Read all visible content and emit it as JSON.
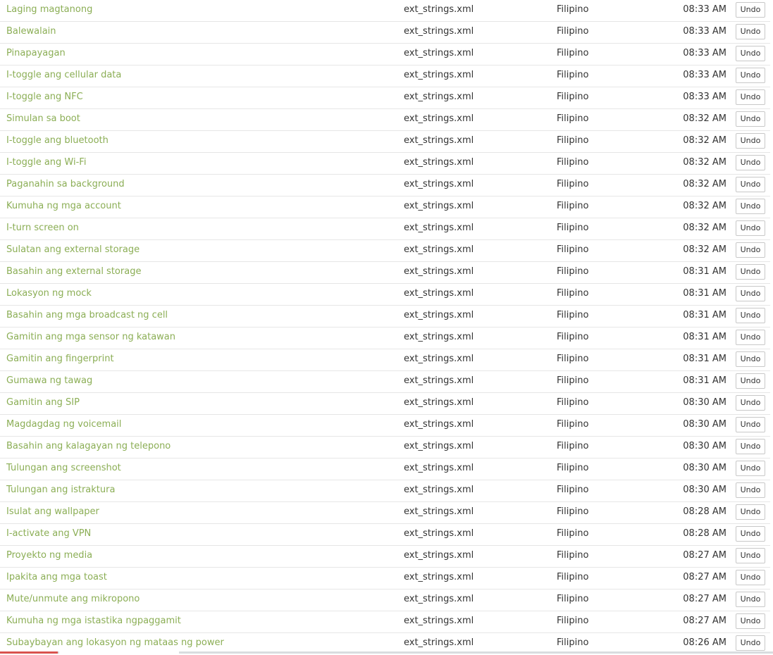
{
  "activity": {
    "undo_label": "Undo",
    "rows": [
      {
        "string": "Laging magtanong",
        "file": "ext_strings.xml",
        "language": "Filipino",
        "time": "08:33 AM"
      },
      {
        "string": "Balewalain",
        "file": "ext_strings.xml",
        "language": "Filipino",
        "time": "08:33 AM"
      },
      {
        "string": "Pinapayagan",
        "file": "ext_strings.xml",
        "language": "Filipino",
        "time": "08:33 AM"
      },
      {
        "string": "I-toggle ang cellular data",
        "file": "ext_strings.xml",
        "language": "Filipino",
        "time": "08:33 AM"
      },
      {
        "string": "I-toggle ang NFC",
        "file": "ext_strings.xml",
        "language": "Filipino",
        "time": "08:33 AM"
      },
      {
        "string": "Simulan sa boot",
        "file": "ext_strings.xml",
        "language": "Filipino",
        "time": "08:32 AM"
      },
      {
        "string": "I-toggle ang bluetooth",
        "file": "ext_strings.xml",
        "language": "Filipino",
        "time": "08:32 AM"
      },
      {
        "string": "I-toggle ang Wi-Fi",
        "file": "ext_strings.xml",
        "language": "Filipino",
        "time": "08:32 AM"
      },
      {
        "string": "Paganahin sa background",
        "file": "ext_strings.xml",
        "language": "Filipino",
        "time": "08:32 AM"
      },
      {
        "string": "Kumuha ng mga account",
        "file": "ext_strings.xml",
        "language": "Filipino",
        "time": "08:32 AM"
      },
      {
        "string": "I-turn screen on",
        "file": "ext_strings.xml",
        "language": "Filipino",
        "time": "08:32 AM"
      },
      {
        "string": "Sulatan ang external storage",
        "file": "ext_strings.xml",
        "language": "Filipino",
        "time": "08:32 AM"
      },
      {
        "string": "Basahin ang external storage",
        "file": "ext_strings.xml",
        "language": "Filipino",
        "time": "08:31 AM"
      },
      {
        "string": "Lokasyon ng mock",
        "file": "ext_strings.xml",
        "language": "Filipino",
        "time": "08:31 AM"
      },
      {
        "string": "Basahin ang mga broadcast ng cell",
        "file": "ext_strings.xml",
        "language": "Filipino",
        "time": "08:31 AM"
      },
      {
        "string": "Gamitin ang mga sensor ng katawan",
        "file": "ext_strings.xml",
        "language": "Filipino",
        "time": "08:31 AM"
      },
      {
        "string": "Gamitin ang fingerprint",
        "file": "ext_strings.xml",
        "language": "Filipino",
        "time": "08:31 AM"
      },
      {
        "string": "Gumawa ng tawag",
        "file": "ext_strings.xml",
        "language": "Filipino",
        "time": "08:31 AM"
      },
      {
        "string": "Gamitin ang SIP",
        "file": "ext_strings.xml",
        "language": "Filipino",
        "time": "08:30 AM"
      },
      {
        "string": "Magdagdag ng voicemail",
        "file": "ext_strings.xml",
        "language": "Filipino",
        "time": "08:30 AM"
      },
      {
        "string": "Basahin ang kalagayan ng telepono",
        "file": "ext_strings.xml",
        "language": "Filipino",
        "time": "08:30 AM"
      },
      {
        "string": "Tulungan ang screenshot",
        "file": "ext_strings.xml",
        "language": "Filipino",
        "time": "08:30 AM"
      },
      {
        "string": "Tulungan ang istraktura",
        "file": "ext_strings.xml",
        "language": "Filipino",
        "time": "08:30 AM"
      },
      {
        "string": "Isulat ang wallpaper",
        "file": "ext_strings.xml",
        "language": "Filipino",
        "time": "08:28 AM"
      },
      {
        "string": "I-activate ang VPN",
        "file": "ext_strings.xml",
        "language": "Filipino",
        "time": "08:28 AM"
      },
      {
        "string": "Proyekto ng media",
        "file": "ext_strings.xml",
        "language": "Filipino",
        "time": "08:27 AM"
      },
      {
        "string": "Ipakita ang mga toast",
        "file": "ext_strings.xml",
        "language": "Filipino",
        "time": "08:27 AM"
      },
      {
        "string": "Mute/unmute ang mikropono",
        "file": "ext_strings.xml",
        "language": "Filipino",
        "time": "08:27 AM"
      },
      {
        "string": "Kumuha ng mga istastika ngpaggamit",
        "file": "ext_strings.xml",
        "language": "Filipino",
        "time": "08:27 AM"
      },
      {
        "string": "Subaybayan ang lokasyon ng mataas ng power",
        "file": "ext_strings.xml",
        "language": "Filipino",
        "time": "08:26 AM"
      }
    ]
  }
}
